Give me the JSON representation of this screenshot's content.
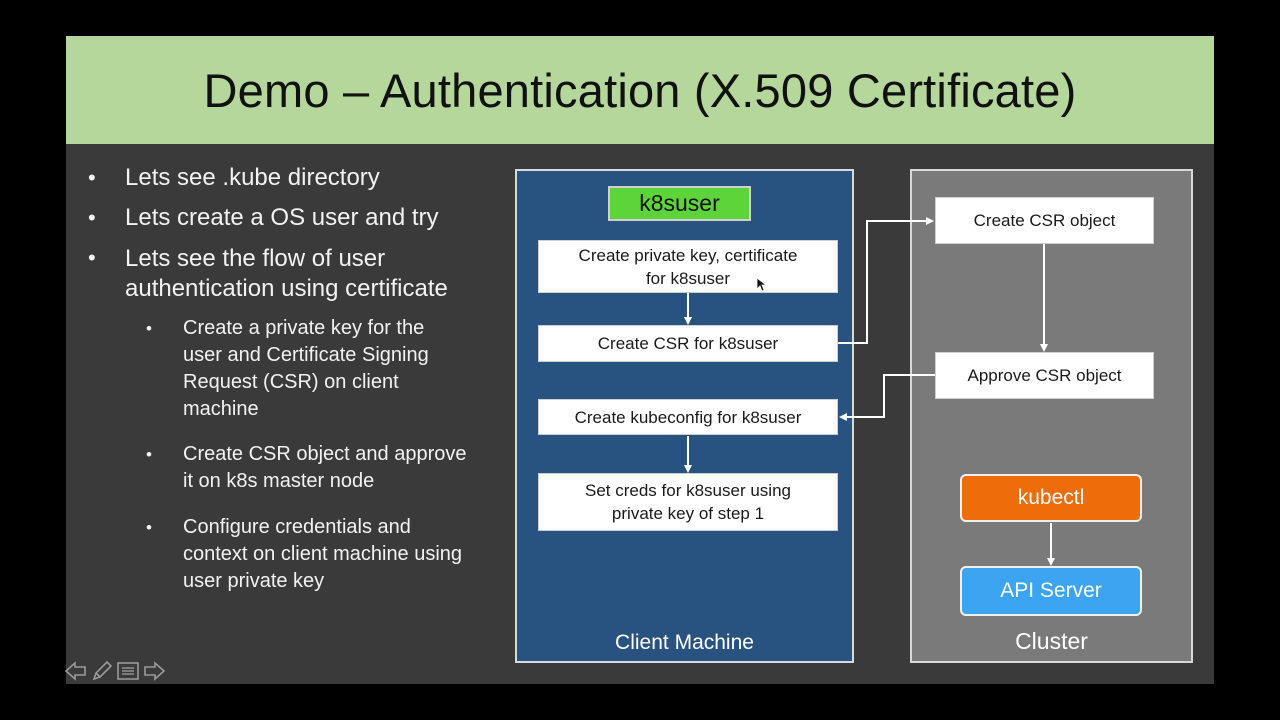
{
  "slide": {
    "title": "Demo – Authentication (X.509 Certificate)",
    "bullets": [
      "Lets see .kube directory",
      "Lets create a OS user and try",
      "Lets see the flow of user",
      "authentication using certificate"
    ],
    "sub_bullets": [
      [
        "Create a private key for the",
        "user and Certificate Signing",
        "Request (CSR) on client",
        "machine"
      ],
      [
        "Create CSR object and approve",
        "it on k8s master node"
      ],
      [
        "Configure credentials and",
        "context on client machine using",
        "user private key"
      ]
    ],
    "bullet_glyph": "•"
  },
  "diagram": {
    "client_label": "Client Machine",
    "cluster_label": "Cluster",
    "user_badge": "k8suser",
    "client_steps": [
      [
        "Create private key, certificate",
        "for k8suser"
      ],
      [
        "Create CSR for k8suser"
      ],
      [
        "Create kubeconfig for k8suser"
      ],
      [
        "Set creds for k8suser using",
        "private key of step 1"
      ]
    ],
    "cluster_steps": [
      "Create CSR object",
      "Approve CSR object"
    ],
    "kubectl_label": "kubectl",
    "api_server_label": "API Server"
  },
  "colors": {
    "title_bar": "#b6d79b",
    "slide_bg": "#3a3a3a",
    "client_panel": "#28527f",
    "cluster_panel": "#7a7a7a",
    "user_badge": "#5cd43a",
    "kubectl": "#ef6c0a",
    "api_server": "#3ba5f2"
  },
  "nav": {
    "icons": [
      "prev-arrow-icon",
      "pen-icon",
      "menu-icon",
      "next-arrow-icon"
    ]
  }
}
